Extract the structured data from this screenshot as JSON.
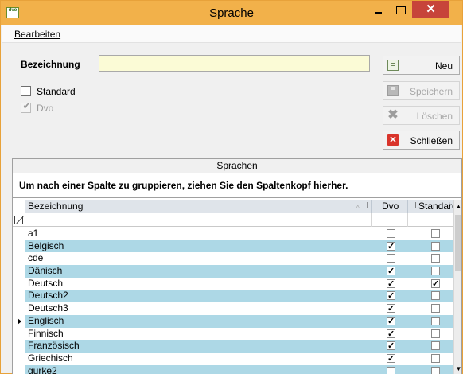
{
  "window": {
    "title": "Sprache",
    "app_icon_text": "dvo",
    "minimize": "–",
    "maximize": "□",
    "close": "✕"
  },
  "menu": {
    "items": [
      "Bearbeiten"
    ]
  },
  "form": {
    "bezeichnung_label": "Bezeichnung",
    "bezeichnung_value": "",
    "standard_label": "Standard",
    "standard_checked": false,
    "dvo_label": "Dvo",
    "dvo_checked": true
  },
  "buttons": {
    "neu": "Neu",
    "speichern": "Speichern",
    "loeschen": "Löschen",
    "schliessen": "Schließen"
  },
  "panel": {
    "title": "Sprachen",
    "group_hint": "Um nach einer Spalte zu gruppieren, ziehen Sie den Spaltenkopf hierher."
  },
  "grid": {
    "columns": [
      "Bezeichnung",
      "Dvo",
      "Standard"
    ],
    "rows": [
      {
        "bezeichnung": "a1",
        "dvo": false,
        "standard": false
      },
      {
        "bezeichnung": "Belgisch",
        "dvo": true,
        "standard": false
      },
      {
        "bezeichnung": "cde",
        "dvo": false,
        "standard": false
      },
      {
        "bezeichnung": "Dänisch",
        "dvo": true,
        "standard": false
      },
      {
        "bezeichnung": "Deutsch",
        "dvo": true,
        "standard": true
      },
      {
        "bezeichnung": "Deutsch2",
        "dvo": true,
        "standard": false
      },
      {
        "bezeichnung": "Deutsch3",
        "dvo": true,
        "standard": false
      },
      {
        "bezeichnung": "Englisch",
        "dvo": true,
        "standard": false,
        "current": true
      },
      {
        "bezeichnung": "Finnisch",
        "dvo": true,
        "standard": false
      },
      {
        "bezeichnung": "Französisch",
        "dvo": true,
        "standard": false
      },
      {
        "bezeichnung": "Griechisch",
        "dvo": true,
        "standard": false
      },
      {
        "bezeichnung": "gurke2",
        "dvo": false,
        "standard": false
      }
    ]
  },
  "colors": {
    "titlebar": "#f2b14a",
    "close_button": "#c7443a",
    "row_alt": "#add8e6",
    "input_bg": "#fbfbd6"
  }
}
